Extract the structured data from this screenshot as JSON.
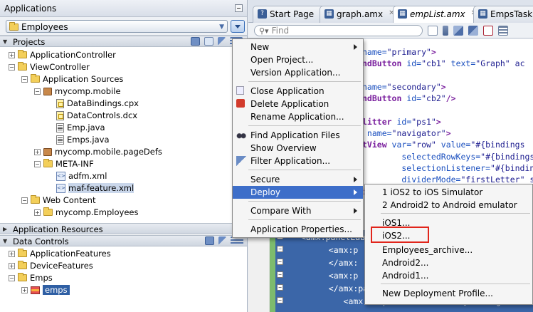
{
  "applications_panel": {
    "title": "Applications",
    "selected_app": "Employees"
  },
  "projects": {
    "title": "Projects",
    "tree": [
      {
        "label": "ApplicationController",
        "depth": 0,
        "icon": "folder-icon",
        "toggle": "+"
      },
      {
        "label": "ViewController",
        "depth": 0,
        "icon": "folder-icon",
        "toggle": "-"
      },
      {
        "label": "Application Sources",
        "depth": 1,
        "icon": "folder-icon",
        "toggle": "-"
      },
      {
        "label": "mycomp.mobile",
        "depth": 2,
        "icon": "package-icon",
        "toggle": "-"
      },
      {
        "label": "DataBindings.cpx",
        "depth": 3,
        "icon": "cpx-file-icon",
        "toggle": ""
      },
      {
        "label": "DataControls.dcx",
        "depth": 3,
        "icon": "cpx-file-icon",
        "toggle": ""
      },
      {
        "label": "Emp.java",
        "depth": 3,
        "icon": "java-file-icon",
        "toggle": ""
      },
      {
        "label": "Emps.java",
        "depth": 3,
        "icon": "java-file-icon",
        "toggle": ""
      },
      {
        "label": "mycomp.mobile.pageDefs",
        "depth": 2,
        "icon": "package-icon",
        "toggle": "+"
      },
      {
        "label": "META-INF",
        "depth": 2,
        "icon": "folder-icon",
        "toggle": "-"
      },
      {
        "label": "adfm.xml",
        "depth": 3,
        "icon": "xml-file-icon",
        "toggle": ""
      },
      {
        "label": "maf-feature.xml",
        "depth": 3,
        "icon": "xml-file-icon",
        "toggle": "",
        "selected": true
      },
      {
        "label": "Web Content",
        "depth": 1,
        "icon": "folder-icon",
        "toggle": "-"
      },
      {
        "label": "mycomp.Employees",
        "depth": 2,
        "icon": "folder-icon",
        "toggle": "+"
      }
    ]
  },
  "app_resources": {
    "title": "Application Resources"
  },
  "data_controls": {
    "title": "Data Controls",
    "tree": [
      {
        "label": "ApplicationFeatures",
        "depth": 0,
        "toggle": "+"
      },
      {
        "label": "DeviceFeatures",
        "depth": 0,
        "toggle": "+"
      },
      {
        "label": "Emps",
        "depth": 0,
        "toggle": "-"
      },
      {
        "label": "emps",
        "depth": 1,
        "toggle": "+",
        "selected": true
      }
    ]
  },
  "tabs": [
    {
      "label": "Start Page",
      "icon": "?",
      "active": false
    },
    {
      "label": "graph.amx",
      "icon": "▦",
      "active": false
    },
    {
      "label": "empList.amx",
      "icon": "▦",
      "active": true
    },
    {
      "label": "EmpsTaskF",
      "icon": "▦",
      "active": false
    }
  ],
  "find": {
    "placeholder": "Find"
  },
  "code_lines": [
    {
      "parts": [
        [
          "attr",
          "name="
        ],
        [
          "str",
          "\"primary\""
        ],
        [
          "kw",
          ">"
        ]
      ]
    },
    {
      "parts": [
        [
          "kw",
          "ndButton "
        ],
        [
          "attr",
          "id="
        ],
        [
          "str",
          "\"cb1\" "
        ],
        [
          "attr",
          "text="
        ],
        [
          "str",
          "\"Graph\" ac"
        ]
      ]
    },
    {
      "parts": []
    },
    {
      "parts": [
        [
          "attr",
          "name="
        ],
        [
          "str",
          "\"secondary\""
        ],
        [
          "kw",
          ">"
        ]
      ]
    },
    {
      "parts": [
        [
          "kw",
          "ndButton "
        ],
        [
          "attr",
          "id="
        ],
        [
          "str",
          "\"cb2\""
        ],
        [
          "kw",
          "/>"
        ]
      ]
    },
    {
      "parts": []
    },
    {
      "parts": [
        [
          "kw",
          "litter "
        ],
        [
          "attr",
          "id="
        ],
        [
          "str",
          "\"ps1\""
        ],
        [
          "kw",
          ">"
        ]
      ]
    },
    {
      "parts": [
        [
          "attr",
          " name="
        ],
        [
          "str",
          "\"navigator\""
        ],
        [
          "kw",
          ">"
        ]
      ]
    },
    {
      "parts": [
        [
          "kw",
          "tView "
        ],
        [
          "attr",
          "var="
        ],
        [
          "str",
          "\"row\" "
        ],
        [
          "attr",
          "value="
        ],
        [
          "str",
          "\"#{bindings"
        ]
      ]
    },
    {
      "parts": [
        [
          "attr",
          "        selectedRowKeys="
        ],
        [
          "str",
          "\"#{bindings"
        ]
      ]
    },
    {
      "parts": [
        [
          "attr",
          "        selectionListener="
        ],
        [
          "str",
          "\"#{bindin"
        ]
      ]
    },
    {
      "parts": [
        [
          "attr",
          "        dividerMode="
        ],
        [
          "str",
          "\"firstLetter\" s"
        ]
      ]
    },
    {
      "parts": [
        [
          "kw",
          "istItem "
        ],
        [
          "attr",
          "id="
        ],
        [
          "str",
          "\"li1\""
        ],
        [
          "kw",
          ">"
        ]
      ]
    }
  ],
  "selected_code": [
    "<amx:panelLabelAndMessage",
    "   <amx:p",
    "   </amx:",
    "   <amx:p",
    "   </amx:panelLabelAndMessage>",
    "      <amx:outputText value=\"#{bindings.name"
  ],
  "context_menu": {
    "items": [
      {
        "label": "New",
        "submenu": true
      },
      {
        "label": "Open Project...",
        "submenu": false
      },
      {
        "label": "Version Application...",
        "submenu": false
      },
      {
        "label": "Close Application",
        "submenu": false
      },
      {
        "label": "Delete Application",
        "submenu": false
      },
      {
        "label": "Rename Application...",
        "submenu": false
      },
      {
        "label": "Find Application Files",
        "submenu": false
      },
      {
        "label": "Show Overview",
        "submenu": false
      },
      {
        "label": "Filter Application...",
        "submenu": false
      },
      {
        "label": "Secure",
        "submenu": true
      },
      {
        "label": "Deploy",
        "submenu": true,
        "highlighted": true
      },
      {
        "label": "Compare With",
        "submenu": true
      },
      {
        "label": "Application Properties...",
        "submenu": false
      }
    ]
  },
  "deploy_submenu": {
    "items": [
      {
        "label": "1  iOS2 to iOS Simulator"
      },
      {
        "label": "2  Android2 to Android emulator"
      },
      {
        "label": "iOS1..."
      },
      {
        "label": "iOS2...",
        "boxed": true
      },
      {
        "label": "Employees_archive..."
      },
      {
        "label": "Android2..."
      },
      {
        "label": "Android1..."
      },
      {
        "label": "New Deployment Profile..."
      }
    ]
  },
  "colors": {
    "menu_highlight": "#3d6ec9",
    "callout_red": "#e1251b",
    "selection_blue": "#3b66a8"
  }
}
